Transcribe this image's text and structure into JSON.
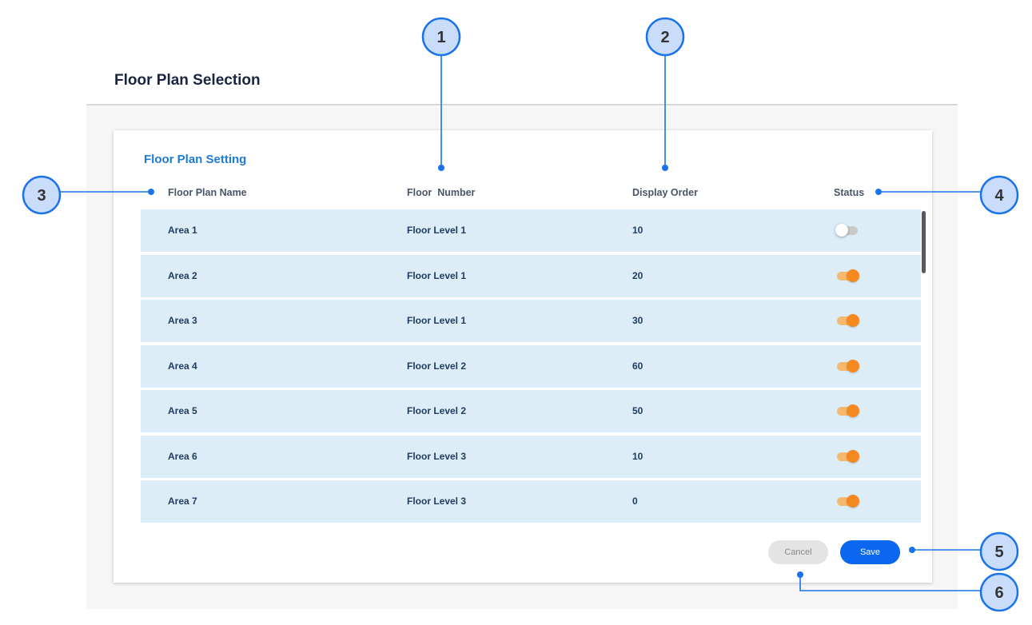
{
  "page": {
    "title": "Floor Plan Selection"
  },
  "card": {
    "title": "Floor Plan Setting",
    "columns": {
      "name": "Floor Plan Name",
      "floor": "Floor  Number",
      "order": "Display Order",
      "status": "Status"
    },
    "rows": [
      {
        "name": "Area 1",
        "floor": "Floor Level 1",
        "order": "10",
        "enabled": false
      },
      {
        "name": "Area 2",
        "floor": "Floor Level 1",
        "order": "20",
        "enabled": true
      },
      {
        "name": "Area 3",
        "floor": "Floor Level 1",
        "order": "30",
        "enabled": true
      },
      {
        "name": "Area 4",
        "floor": "Floor Level 2",
        "order": "60",
        "enabled": true
      },
      {
        "name": "Area 5",
        "floor": "Floor Level 2",
        "order": "50",
        "enabled": true
      },
      {
        "name": "Area 6",
        "floor": "Floor Level 3",
        "order": "10",
        "enabled": true
      },
      {
        "name": "Area 7",
        "floor": "Floor Level 3",
        "order": "0",
        "enabled": true
      }
    ],
    "buttons": {
      "cancel": "Cancel",
      "save": "Save"
    }
  },
  "callouts": {
    "labels": [
      "1",
      "2",
      "3",
      "4",
      "5",
      "6"
    ]
  },
  "colors": {
    "accent": "#0b66f0",
    "title_blue": "#1c7ad8",
    "row_bg": "#dcedf7",
    "toggle_on": "#f4891f",
    "callout_fill": "#c9ddfa",
    "callout_stroke": "#1a73e8"
  }
}
